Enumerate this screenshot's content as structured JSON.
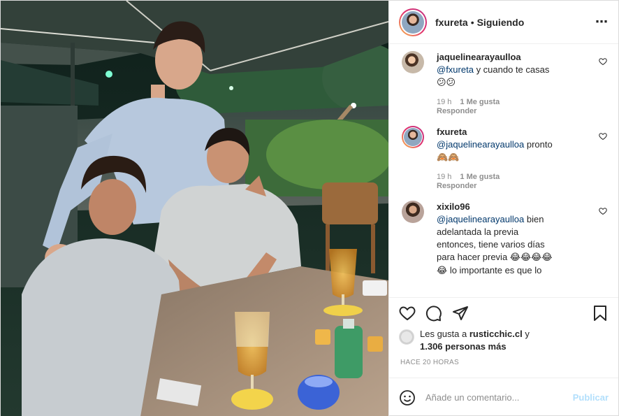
{
  "post": {
    "author": "fxureta",
    "separator": "•",
    "follow_status": "Siguiendo",
    "more_icon": "⋯"
  },
  "comments": [
    {
      "user": "jaquelinearayaulloa",
      "mention": "@fxureta",
      "text": " y cuando te casas ",
      "emoji": "😕😕",
      "time": "19 h",
      "likes": "1 Me gusta",
      "reply": "Responder"
    },
    {
      "user": "fxureta",
      "mention": "@jaquelinearayaulloa",
      "text": " pronto ",
      "emoji": "🙈🙈",
      "time": "19 h",
      "likes": "1 Me gusta",
      "reply": "Responder"
    },
    {
      "user": "xixilo96",
      "mention": "@jaquelinearayaulloa",
      "text": " bien adelantada la previa entonces, tiene varios días para hacer previa ",
      "emoji": "😂😂😂😂😂",
      "text2": " lo importante es que lo "
    }
  ],
  "likes": {
    "prefix": "Les gusta a ",
    "user": "rusticchic.cl",
    "middle": " y ",
    "others": "1.306 personas más"
  },
  "time_ago": "HACE 20 HORAS",
  "add_comment": {
    "placeholder": "Añade un comentario...",
    "publish_label": "Publicar"
  },
  "icons": {
    "like": "heart-icon",
    "comment": "comment-icon",
    "share": "share-icon",
    "save": "bookmark-icon",
    "emoji": "emoji-icon"
  }
}
